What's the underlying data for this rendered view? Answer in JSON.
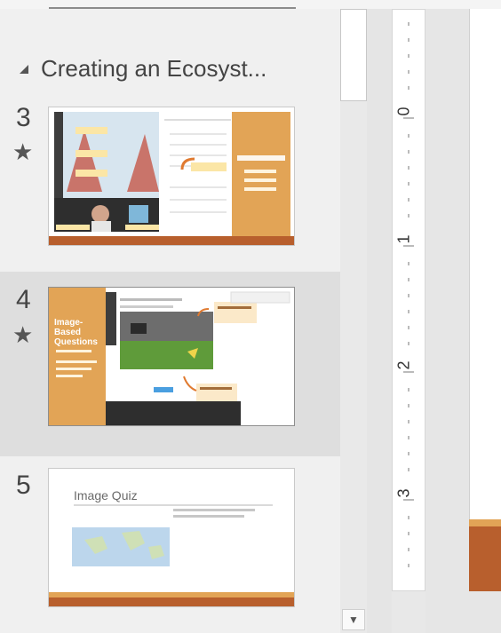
{
  "section": {
    "title": "Creating an Ecosyst..."
  },
  "slides": [
    {
      "number": "3",
      "starred": true
    },
    {
      "number": "4",
      "starred": true,
      "side_title": "Image-Based Questions"
    },
    {
      "number": "5",
      "starred": false,
      "title": "Image Quiz"
    }
  ],
  "icons": {
    "collapse": "collapse-triangle-icon",
    "star": "star-icon",
    "scroll_down": "chevron-down-icon"
  },
  "ruler": {
    "labels": [
      "0",
      "1",
      "2",
      "3"
    ]
  },
  "colors": {
    "accent_orange": "#e2a456",
    "accent_rust": "#b85f2d",
    "selection": "#dedede"
  }
}
